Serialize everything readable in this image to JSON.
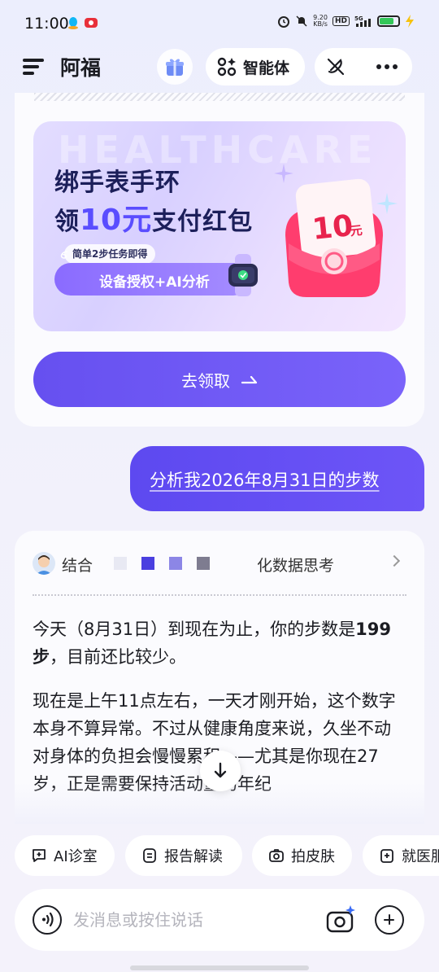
{
  "status_bar": {
    "time": "11:00",
    "net_speed_value": "9.20",
    "net_speed_unit": "KB/s",
    "hd_label": "HD",
    "network": "5G"
  },
  "header": {
    "title": "阿福",
    "agent_label": "智能体"
  },
  "promo": {
    "bg_text": "HEALTHCARE",
    "title_line1": "绑手表手环",
    "title_line2_prefix": "领",
    "title_line2_highlight": "10元",
    "title_line2_suffix": "支付红包",
    "task_hint": "简单2步任务即得",
    "task_steps": "设备授权+AI分析",
    "packet_amount": "10",
    "packet_unit": "元",
    "claim_label": "去领取"
  },
  "user_message": {
    "text": "分析我2026年8月31日的步数"
  },
  "ai_answer": {
    "think_prefix": "结合",
    "think_suffix": "化数据思考",
    "para1_a": "今天（8月31日）到现在为止，你的步数是",
    "para1_bold": "199步",
    "para1_b": "，目前还比较少。",
    "para2": "现在是上午11点左右，一天才刚开始，这个数字本身不算异常。不过从健康角度来说，久坐不动对身体的负担会慢慢累积——尤其是你现在27岁，正是需要保持活动量的年纪"
  },
  "chips": [
    {
      "label": "AI诊室",
      "icon": "chat-plus-icon"
    },
    {
      "label": "报告解读",
      "icon": "report-icon"
    },
    {
      "label": "拍皮肤",
      "icon": "camera-icon"
    },
    {
      "label": "就医服务",
      "icon": "hospital-icon"
    }
  ],
  "input": {
    "placeholder": "发消息或按住说话"
  },
  "colors": {
    "accent": "#6650f0",
    "highlight": "#5a4dff",
    "title_dark": "#1c1f5a"
  }
}
